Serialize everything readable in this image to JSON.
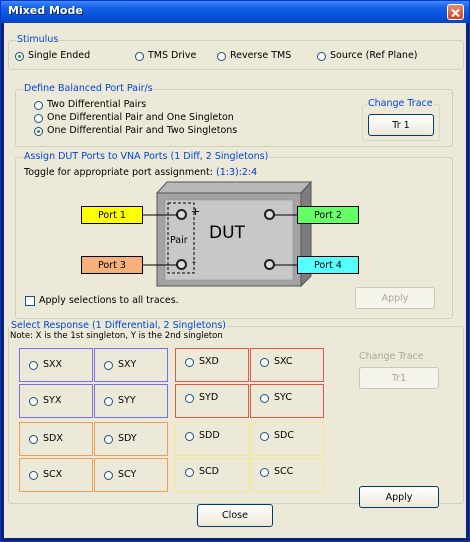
{
  "window": {
    "title": "Mixed Mode"
  },
  "stimulus": {
    "title": "Stimulus",
    "options": [
      "Single Ended",
      "TMS Drive",
      "Reverse TMS",
      "Source (Ref Plane)"
    ]
  },
  "balanced": {
    "title": "Define Balanced Port Pair/s",
    "options": [
      "Two Differential Pairs",
      "One Differential Pair and One Singleton",
      "One Differential Pair and Two Singletons"
    ],
    "change_trace_title": "Change Trace",
    "trace_button": "Tr 1"
  },
  "assign": {
    "title": "Assign DUT Ports to VNA Ports (1 Diff, 2 Singletons)",
    "toggle_label": "Toggle for appropriate port assignment:",
    "toggle_link": "(1:3):2:4",
    "dut_label": "DUT",
    "pair_label": "Pair",
    "plus": "+",
    "minus": "-",
    "ports": [
      "Port 1",
      "Port 3",
      "Port 2",
      "Port 4"
    ],
    "apply_all_label": "Apply selections to all traces.",
    "apply_button": "Apply"
  },
  "response": {
    "title": "Select Response (1 Differential, 2 Singletons)",
    "note": "Note: X is the 1st singleton, Y is the 2nd singleton",
    "params": [
      "SXX",
      "SXY",
      "SXD",
      "SXC",
      "SYX",
      "SYY",
      "SYD",
      "SYC",
      "SDX",
      "SDY",
      "SDD",
      "SDC",
      "SCX",
      "SCY",
      "SCD",
      "SCC"
    ],
    "change_trace_title": "Change Trace",
    "trace_button": "Tr1",
    "apply_button": "Apply"
  },
  "footer": {
    "close_button": "Close"
  },
  "colors": {
    "port1": "#ffff00",
    "port3": "#f8b07a",
    "port2": "#66ff66",
    "port4": "#55ffff",
    "box_blue": "#7b6fe0",
    "box_red": "#e05a4a",
    "box_orange": "#f0a050",
    "box_yellow": "#f5e88c"
  }
}
